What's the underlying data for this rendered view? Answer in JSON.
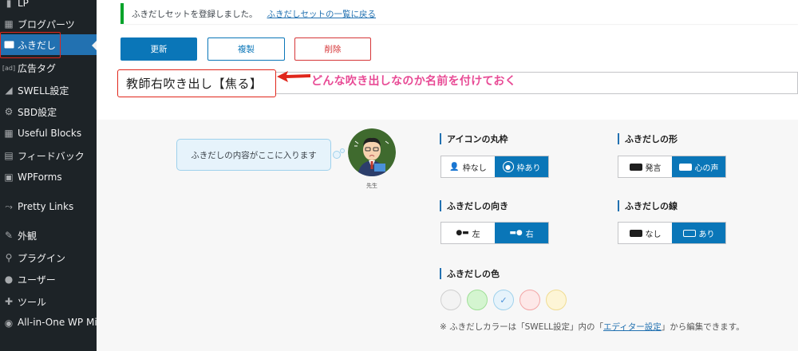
{
  "sidebar": {
    "items": [
      {
        "label": "LP",
        "icon": "page-icon"
      },
      {
        "label": "ブログパーツ",
        "icon": "grid-icon"
      },
      {
        "label": "ふきだし",
        "icon": "speech-bubble-icon"
      },
      {
        "label": "広告タグ",
        "icon": "ad-icon"
      },
      {
        "label": "SWELL設定",
        "icon": "swell-icon"
      },
      {
        "label": "SBD設定",
        "icon": "gear-icon"
      },
      {
        "label": "Useful Blocks",
        "icon": "blocks-icon"
      },
      {
        "label": "フィードバック",
        "icon": "feedback-icon"
      },
      {
        "label": "WPForms",
        "icon": "form-icon"
      },
      {
        "label": "Pretty Links",
        "icon": "link-icon"
      },
      {
        "label": "外観",
        "icon": "brush-icon"
      },
      {
        "label": "プラグイン",
        "icon": "plugin-icon"
      },
      {
        "label": "ユーザー",
        "icon": "user-icon"
      },
      {
        "label": "ツール",
        "icon": "wrench-icon"
      },
      {
        "label": "All-in-One WP Migration",
        "icon": "migration-icon"
      }
    ]
  },
  "notice": {
    "message": "ふきだしセットを登録しました。",
    "link": "ふきだしセットの一覧に戻る"
  },
  "actions": {
    "update": "更新",
    "duplicate": "複製",
    "delete": "削除"
  },
  "title_field": {
    "value": "教師右吹き出し【焦る】"
  },
  "annotation": "どんな吹き出しなのか名前を付けておく",
  "preview": {
    "bubble_text": "ふきだしの内容がここに入ります",
    "avatar_name": "先生"
  },
  "options": {
    "icon_frame": {
      "title": "アイコンの丸枠",
      "off": "枠なし",
      "on": "枠あり"
    },
    "shape": {
      "title": "ふきだしの形",
      "a": "発言",
      "b": "心の声"
    },
    "direction": {
      "title": "ふきだしの向き",
      "left": "左",
      "right": "右"
    },
    "border": {
      "title": "ふきだしの線",
      "off": "なし",
      "on": "あり"
    },
    "color": {
      "title": "ふきだしの色",
      "swatches": [
        {
          "name": "gray",
          "bg": "#f3f3f3",
          "border": "#cfcfcf"
        },
        {
          "name": "green",
          "bg": "#d4f5d0",
          "border": "#9fdf97"
        },
        {
          "name": "blue",
          "bg": "#e6f3fb",
          "border": "#9fd1ec"
        },
        {
          "name": "red",
          "bg": "#fde8e8",
          "border": "#f3a5a5"
        },
        {
          "name": "yellow",
          "bg": "#fdf5d6",
          "border": "#f0dc92"
        }
      ]
    }
  },
  "footnote": {
    "prefix": "※ ふきだしカラーは「SWELL設定」内の「",
    "link": "エディター設定",
    "suffix": "」から編集できます。"
  }
}
